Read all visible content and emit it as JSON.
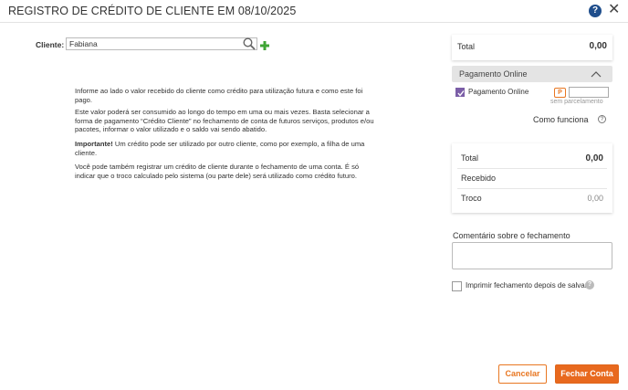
{
  "header": {
    "title": "REGISTRO DE CRÉDITO DE CLIENTE EM 08/10/2025",
    "help_icon": "?",
    "close_icon": "✕"
  },
  "client": {
    "label": "Cliente:",
    "value": "Fabiana"
  },
  "info": {
    "p1": "Informe ao lado o valor recebido do cliente como crédito para utilização futura e como este foi pago.",
    "p2": "Este valor poderá ser consumido ao longo do tempo em uma ou mais vezes. Basta selecionar a forma de pagamento “Crédito Cliente” no fechamento de conta de futuros serviços, produtos e/ou pacotes, informar o valor utilizado e o saldo vai sendo abatido.",
    "p3_bold": "Importante!",
    "p3": " Um crédito pode ser utilizado por outro cliente, como por exemplo, a filha de uma cliente.",
    "p4": "Você pode também registrar um crédito de cliente durante o fechamento de uma conta. É só indicar que o troco calculado pelo sistema (ou parte dele) será utilizado como crédito futuro."
  },
  "total_panel": {
    "label": "Total",
    "value": "0,00"
  },
  "online": {
    "header": "Pagamento Online",
    "checkbox_label": "Pagamento Online",
    "checked": true,
    "badge": "P",
    "parcelamento": "sem parcelamento",
    "como_funciona": "Como funciona",
    "q_icon": "?"
  },
  "summary": {
    "total_label": "Total",
    "total_value": "0,00",
    "recebido_label": "Recebido",
    "troco_label": "Troco",
    "troco_value": "0,00"
  },
  "comment": {
    "label": "Comentário sobre o fechamento",
    "value": ""
  },
  "print": {
    "label": "Imprimir fechamento depois de salvar",
    "checked": false,
    "info_icon": "?"
  },
  "buttons": {
    "cancel": "Cancelar",
    "confirm": "Fechar Conta"
  },
  "colors": {
    "accent": "#e8691e",
    "check": "#7b5ea7",
    "help": "#1f4e8c"
  }
}
